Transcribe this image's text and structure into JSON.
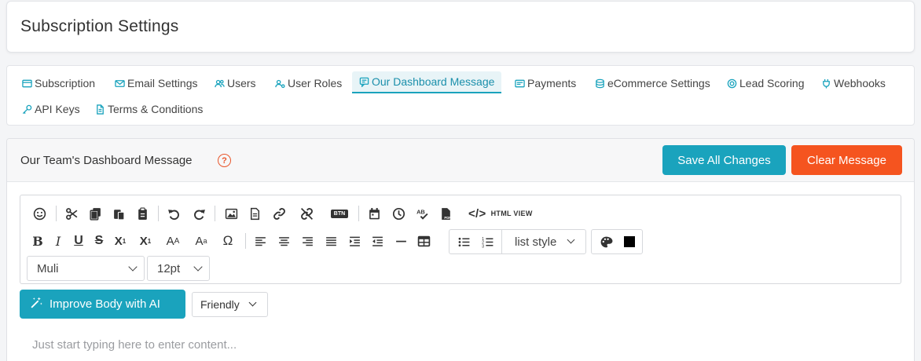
{
  "page": {
    "title": "Subscription Settings"
  },
  "tabs": [
    {
      "label": "Subscription",
      "icon": "subscription-icon"
    },
    {
      "label": "Email Settings",
      "icon": "envelope-icon"
    },
    {
      "label": "Users",
      "icon": "users-icon"
    },
    {
      "label": "User Roles",
      "icon": "user-roles-icon"
    },
    {
      "label": "Our Dashboard Message",
      "icon": "message-icon",
      "active": true
    },
    {
      "label": "Payments",
      "icon": "payments-icon"
    },
    {
      "label": "eCommerce Settings",
      "icon": "database-icon"
    },
    {
      "label": "Lead Scoring",
      "icon": "lead-scoring-icon"
    },
    {
      "label": "Webhooks",
      "icon": "plug-icon"
    },
    {
      "label": "API Keys",
      "icon": "key-icon"
    },
    {
      "label": "Terms & Conditions",
      "icon": "document-icon"
    }
  ],
  "panel": {
    "title": "Our Team's Dashboard Message",
    "help": "?",
    "save_label": "Save All Changes",
    "clear_label": "Clear Message"
  },
  "editor": {
    "html_view_label": "HTML VIEW",
    "btn_badge": "BTN",
    "list_style": "list style",
    "font_family": "Muli",
    "font_size": "12pt",
    "text_color": "#000000",
    "omega": "Ω",
    "placeholder": "Just start typing here to enter content..."
  },
  "ai": {
    "improve_label": "Improve Body with AI",
    "tone": "Friendly"
  },
  "colors": {
    "accent": "#1aa3bd",
    "danger": "#f5541f",
    "help": "#e8562b"
  }
}
